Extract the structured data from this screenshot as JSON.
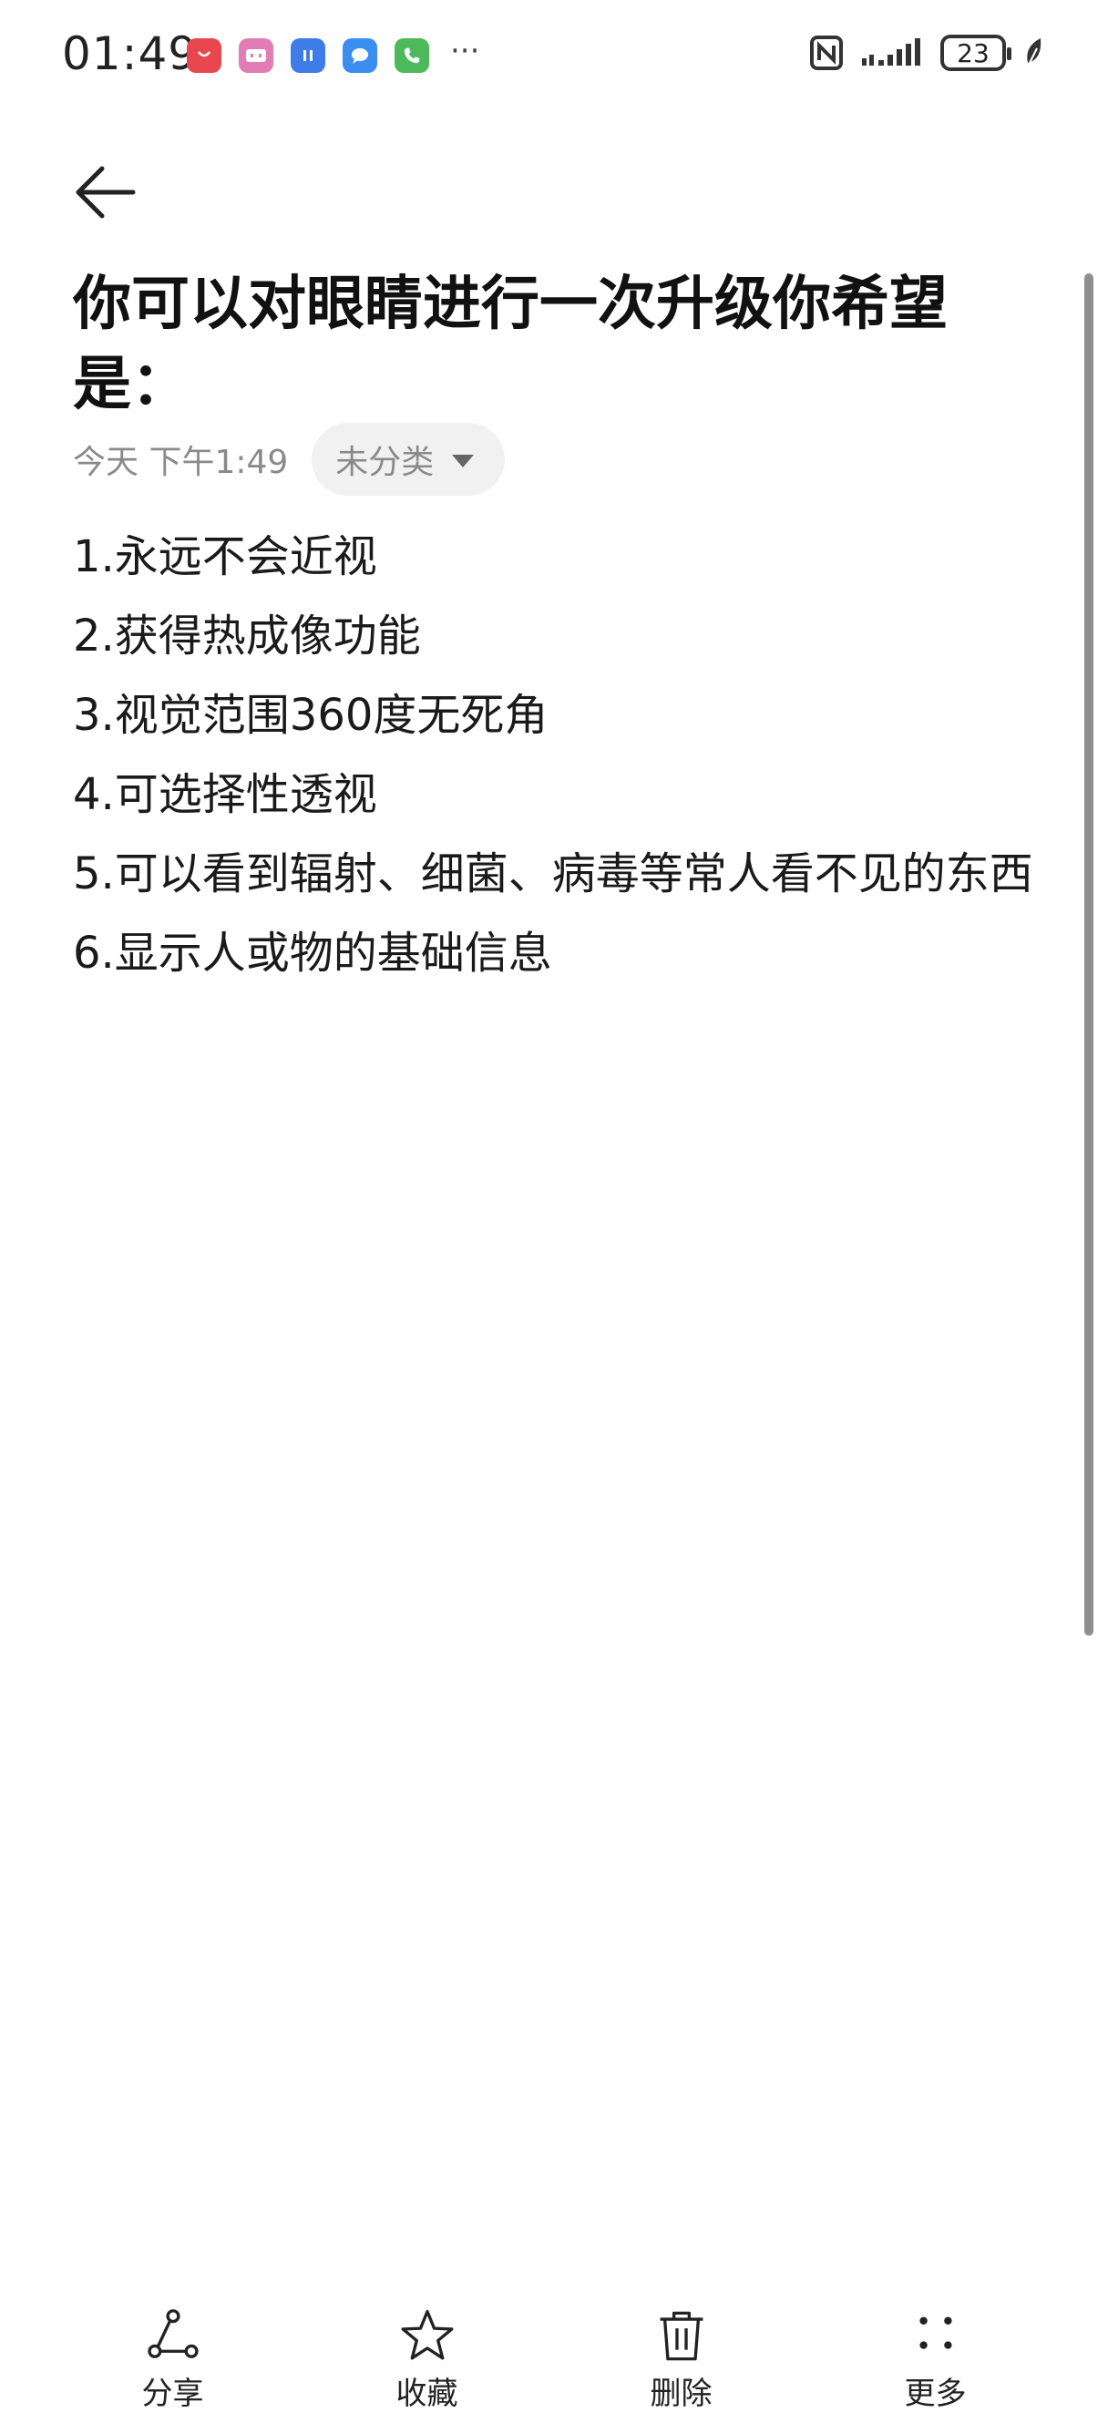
{
  "status_bar": {
    "time": "01:49",
    "battery": "23",
    "notification_icons": [
      {
        "name": "huawei-appgallery-icon",
        "color": "#e8474f"
      },
      {
        "name": "bilibili-icon",
        "color": "#e27cb5"
      },
      {
        "name": "app-icon-blue",
        "color": "#3d7ce9"
      },
      {
        "name": "messages-icon",
        "color": "#3a8ef0"
      },
      {
        "name": "phone-icon",
        "color": "#4cba5a"
      }
    ],
    "more": "···"
  },
  "note": {
    "title": "你可以对眼睛进行一次升级你希望是：",
    "date": "今天 下午1:49",
    "category": "未分类",
    "lines": [
      "1.永远不会近视",
      "2.获得热成像功能",
      "3.视觉范围360度无死角",
      "4.可选择性透视",
      "5.可以看到辐射、细菌、病毒等常人看不见的东西",
      "6.显示人或物的基础信息"
    ]
  },
  "toolbar": {
    "share": "分享",
    "favorite": "收藏",
    "delete": "删除",
    "more": "更多"
  }
}
